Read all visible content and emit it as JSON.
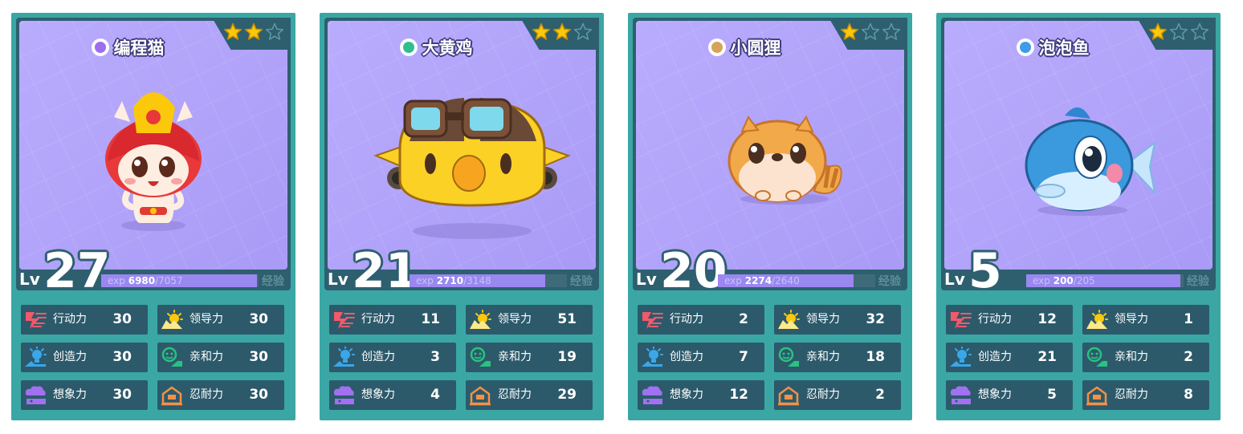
{
  "colors": {
    "card_bg": "#3aa7a5",
    "art_bg": "#b3a6fb",
    "panel": "#2e5f6f",
    "exp_fill": "#9b87f0",
    "star_gold": "#fbc80b"
  },
  "labels": {
    "lv": "Lv",
    "exp": "exp",
    "exp_cn": "经验"
  },
  "stat_names": {
    "action": "行动力",
    "leader": "领导力",
    "create": "创造力",
    "affinity": "亲和力",
    "imagine": "想象力",
    "endure": "忍耐力"
  },
  "cards": [
    {
      "name": "编程猫",
      "icon": "cat-type-icon",
      "icon_color": "#9b6ff0",
      "stars": 2,
      "level": "27",
      "exp_cur": "6980",
      "exp_sep": "/",
      "exp_max": "7057",
      "exp_fraction": 0.99,
      "stats": {
        "action": "30",
        "leader": "30",
        "create": "30",
        "affinity": "30",
        "imagine": "30",
        "endure": "30"
      },
      "mascot": "red-cat"
    },
    {
      "name": "大黄鸡",
      "icon": "leaf-type-icon",
      "icon_color": "#2fbf8f",
      "stars": 2,
      "level": "21",
      "exp_cur": "2710",
      "exp_sep": "/",
      "exp_max": "3148",
      "exp_fraction": 0.86,
      "stats": {
        "action": "11",
        "leader": "51",
        "create": "3",
        "affinity": "19",
        "imagine": "4",
        "endure": "29"
      },
      "mascot": "yellow-chick"
    },
    {
      "name": "小圆狸",
      "icon": "earth-type-icon",
      "icon_color": "#d9a25a",
      "stars": 1,
      "level": "20",
      "exp_cur": "2274",
      "exp_sep": "/",
      "exp_max": "2640",
      "exp_fraction": 0.86,
      "stats": {
        "action": "2",
        "leader": "32",
        "create": "7",
        "affinity": "18",
        "imagine": "12",
        "endure": "2"
      },
      "mascot": "orange-raccoon"
    },
    {
      "name": "泡泡鱼",
      "icon": "water-type-icon",
      "icon_color": "#3f9be8",
      "stars": 1,
      "level": "5",
      "exp_cur": "200",
      "exp_sep": "/",
      "exp_max": "205",
      "exp_fraction": 0.98,
      "stats": {
        "action": "12",
        "leader": "1",
        "create": "21",
        "affinity": "2",
        "imagine": "5",
        "endure": "8"
      },
      "mascot": "blue-fish"
    }
  ]
}
